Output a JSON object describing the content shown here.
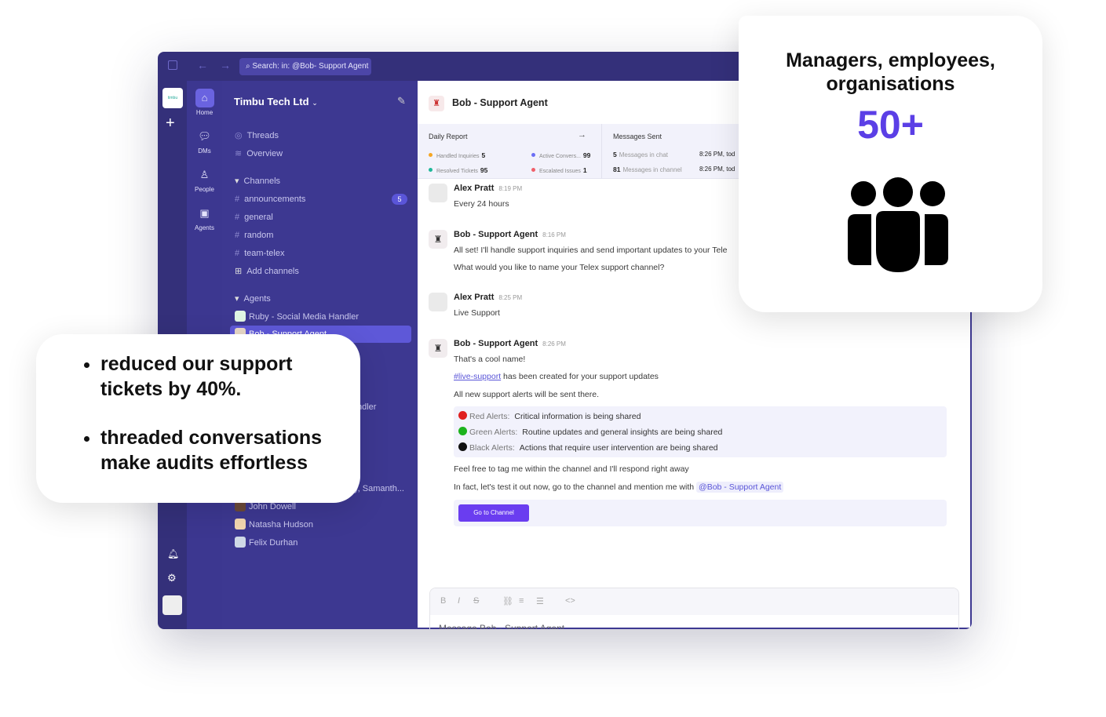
{
  "topbar": {
    "search": "Search: in: @Bob- Support Agent"
  },
  "workspace": {
    "logo": "timbu",
    "name": "Timbu Tech Ltd"
  },
  "nav": [
    {
      "label": "Home",
      "icon": "home-icon"
    },
    {
      "label": "DMs",
      "icon": "chat-icon"
    },
    {
      "label": "People",
      "icon": "person-icon"
    },
    {
      "label": "Agents",
      "icon": "robot-icon"
    }
  ],
  "sidebar": {
    "threads": "Threads",
    "overview": "Overview",
    "channels_header": "Channels",
    "channels": [
      {
        "name": "announcements",
        "badge": "5"
      },
      {
        "name": "general"
      },
      {
        "name": "random"
      },
      {
        "name": "team-telex"
      }
    ],
    "add_channels": "Add channels",
    "agents_header": "Agents",
    "agents": [
      "Ruby - Social Media Handler",
      "Bob - Support Agent"
    ],
    "partial_agent": "ndler",
    "group_dm": "y, Samanth...",
    "dms": [
      "John Dowell",
      "Natasha Hudson",
      "Felix Durhan"
    ]
  },
  "header": {
    "title": "Bob - Support Agent"
  },
  "report": {
    "title": "Daily Report",
    "items": [
      {
        "label": "Handled Inquiries",
        "value": "5",
        "color": "#f5a623"
      },
      {
        "label": "Active Convers...",
        "value": "99",
        "color": "#6b6ef5"
      },
      {
        "label": "Resolved Tickets",
        "value": "95",
        "color": "#1fb89a"
      },
      {
        "label": "Escalated Issues",
        "value": "1",
        "color": "#f0606a"
      }
    ]
  },
  "messages_sent": {
    "title": "Messages Sent",
    "rows": [
      {
        "count": "5",
        "label": "Messages in chat",
        "time": "8:26 PM, tod"
      },
      {
        "count": "81",
        "label": "Messages in channel",
        "time": "8:26 PM, tod"
      }
    ]
  },
  "messages": [
    {
      "name": "Alex Pratt",
      "time": "8:19 PM",
      "lines": [
        "Every 24 hours"
      ]
    },
    {
      "name": "Bob - Support Agent",
      "time": "8:16 PM",
      "lines": [
        "All set! I'll handle support inquiries and send important updates to your Tele",
        "What would you like to name your Telex support channel?"
      ]
    },
    {
      "name": "Alex Pratt",
      "time": "8:25 PM",
      "lines": [
        "Live Support"
      ]
    },
    {
      "name": "Bob - Support Agent",
      "time": "8:26 PM",
      "lines": [
        "That's a cool name!"
      ]
    }
  ],
  "channel_link": "#live-support",
  "channel_link_rest": " has been created for your support updates",
  "alerts_intro": "All new support alerts will be sent there.",
  "alerts": [
    {
      "label": "Red Alerts:",
      "text": "Critical information is being shared",
      "color": "#e02020"
    },
    {
      "label": "Green Alerts:",
      "text": "Routine updates and general insights are being shared",
      "color": "#1db31d"
    },
    {
      "label": "Black Alerts:",
      "text": "Actions that require user intervention are being shared",
      "color": "#111111"
    }
  ],
  "tag_line": "Feel free to tag me within the channel and I'll respond right away",
  "test_line": "In fact, let's test it out now, go to the channel and mention me with",
  "mention": "@Bob - Support Agent",
  "go_button": "Go to Channel",
  "composer": {
    "placeholder": "Message Bob - Support Agent"
  },
  "card_right": {
    "title": "Managers, employees, organisations",
    "stat": "50+",
    "accent": "#5b3fe6"
  },
  "card_left": {
    "bullets": [
      "reduced our support tickets by 40%.",
      "threaded conversations make audits effortless"
    ]
  }
}
